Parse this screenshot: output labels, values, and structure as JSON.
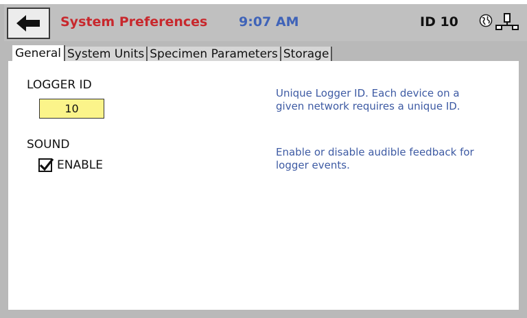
{
  "header": {
    "title": "System Preferences",
    "time": "9:07 AM",
    "device_id": "ID 10",
    "title_color": "#c8282d",
    "time_color": "#3f63b8",
    "icons": [
      "back-arrow-icon",
      "globe-icon",
      "network-icon"
    ]
  },
  "tabs": [
    {
      "label": "General",
      "active": true
    },
    {
      "label": "System Units",
      "active": false
    },
    {
      "label": "Specimen Parameters",
      "active": false
    },
    {
      "label": "Storage",
      "active": false
    }
  ],
  "general": {
    "logger_id": {
      "label": "LOGGER ID",
      "value": "10",
      "help_line1": "Unique Logger ID.  Each device on a",
      "help_line2": "given network requires a unique ID."
    },
    "sound": {
      "label": "SOUND",
      "checkbox_label": "ENABLE",
      "checked": true,
      "help_line1": "Enable or disable audible feedback for",
      "help_line2": "logger events."
    }
  }
}
